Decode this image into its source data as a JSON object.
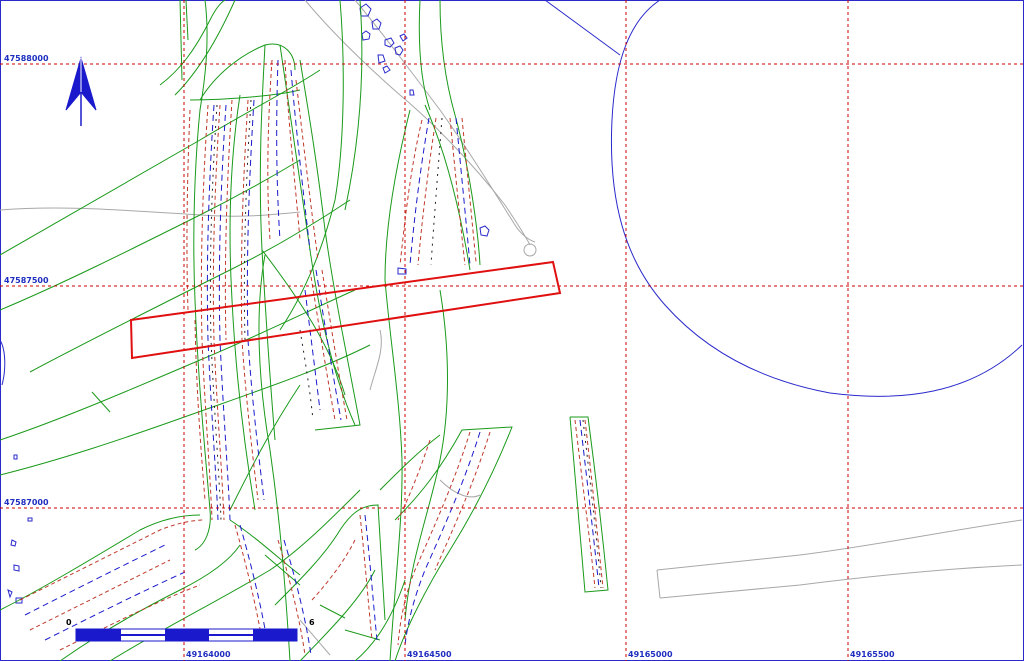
{
  "map": {
    "colors": {
      "background": "#ffffff",
      "grid": "#cc0000",
      "field_outline": "#1a9a1a",
      "hatch_red": "#c0392b",
      "hatch_blue": "#1a1acc",
      "water": "#2a2acc",
      "road": "#a8a8a8",
      "selection": "#e01010"
    },
    "y_labels": [
      "47588000",
      "47587500",
      "47587000"
    ],
    "x_labels": [
      "49164000",
      "49164500",
      "49165000",
      "49165500"
    ],
    "north_arrow": {
      "icon": "north-arrow-icon"
    },
    "scale_bar": {
      "start_label": "0",
      "end_label": "6"
    }
  }
}
